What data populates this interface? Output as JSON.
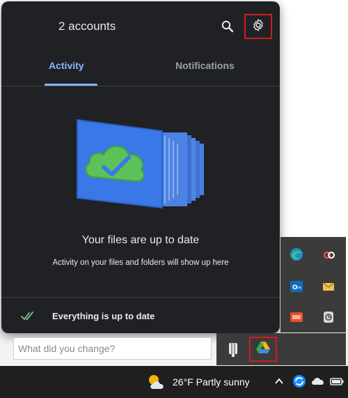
{
  "panel": {
    "accounts_label": "2 accounts",
    "tabs": [
      {
        "label": "Activity",
        "active": true
      },
      {
        "label": "Notifications",
        "active": false
      }
    ],
    "status_title": "Your files are up to date",
    "status_subtitle": "Activity on your files and folders will show up here",
    "footer_text": "Everything is up to date"
  },
  "icons": {
    "search": "search-icon",
    "settings": "gear-icon",
    "check": "double-check-icon"
  },
  "feedback": {
    "placeholder": "What did you change?"
  },
  "taskbar": {
    "weather_text": "26°F  Partly sunny"
  },
  "colors": {
    "panel_bg": "#202124",
    "accent": "#8ab4f8",
    "highlight": "#d11d1d"
  }
}
